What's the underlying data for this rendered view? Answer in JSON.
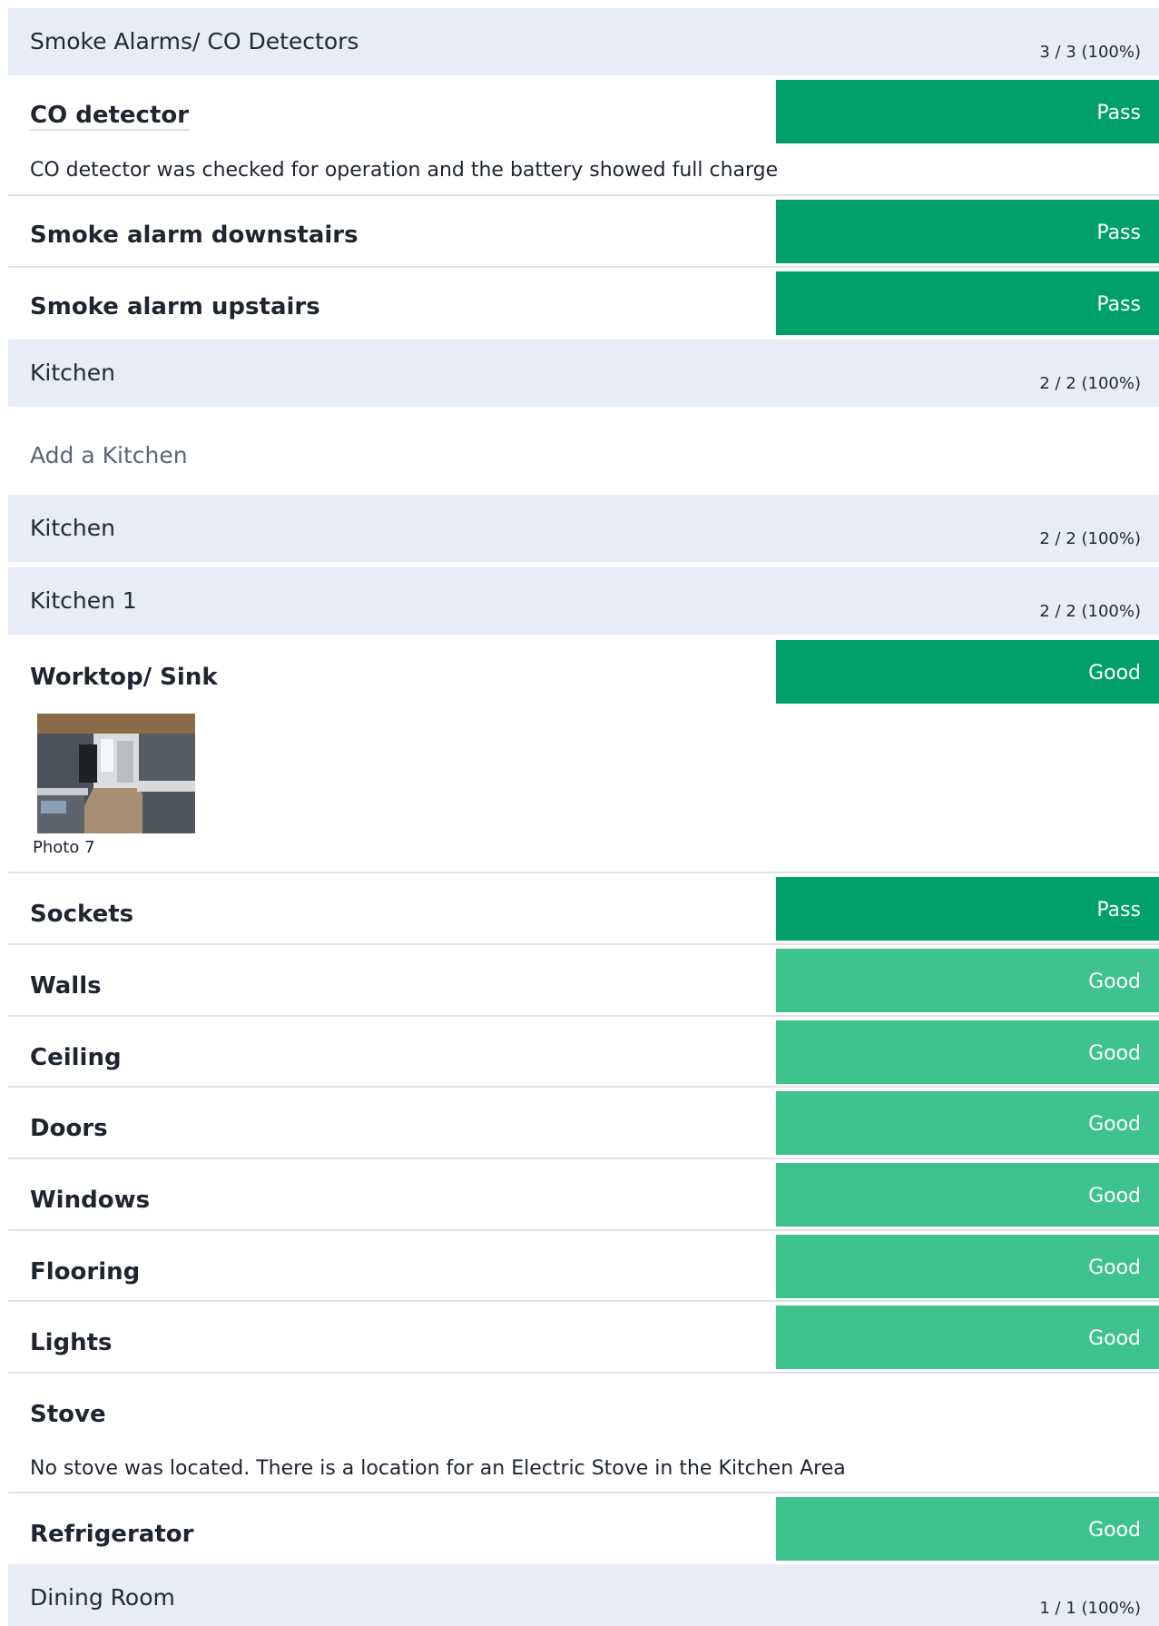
{
  "smoke_section": {
    "title": "Smoke Alarms/ CO Detectors",
    "count": "3 / 3 (100%)"
  },
  "co_detector": {
    "label": "CO detector",
    "status": "Pass",
    "note": "CO detector was checked for operation and the battery showed full charge"
  },
  "smoke_down": {
    "label": "Smoke alarm downstairs",
    "status": "Pass"
  },
  "smoke_up": {
    "label": "Smoke alarm upstairs",
    "status": "Pass"
  },
  "kitchen_section": {
    "title": "Kitchen",
    "count": "2 / 2 (100%)"
  },
  "add_kitchen": "Add a Kitchen",
  "kitchen_sub": {
    "title": "Kitchen",
    "count": "2 / 2 (100%)"
  },
  "kitchen1_sub": {
    "title": "Kitchen 1",
    "count": "2 / 2 (100%)"
  },
  "worktop": {
    "label": "Worktop/ Sink",
    "status": "Good",
    "photo_caption": "Photo 7"
  },
  "sockets": {
    "label": "Sockets",
    "status": "Pass"
  },
  "walls": {
    "label": "Walls",
    "status": "Good"
  },
  "ceiling": {
    "label": "Ceiling",
    "status": "Good"
  },
  "doors": {
    "label": "Doors",
    "status": "Good"
  },
  "windows": {
    "label": "Windows",
    "status": "Good"
  },
  "flooring": {
    "label": "Flooring",
    "status": "Good"
  },
  "lights": {
    "label": "Lights",
    "status": "Good"
  },
  "stove": {
    "label": "Stove",
    "note": "No stove was located. There is a location for an Electric Stove in the Kitchen Area"
  },
  "refrigerator": {
    "label": "Refrigerator",
    "status": "Good"
  },
  "dining_section": {
    "title": "Dining Room",
    "count": "1 / 1 (100%)"
  },
  "colors": {
    "section_bg": "#e8ecf6",
    "pass_dark": "#00a069",
    "good_light": "#3ec38c",
    "divider": "#dde2ea"
  }
}
